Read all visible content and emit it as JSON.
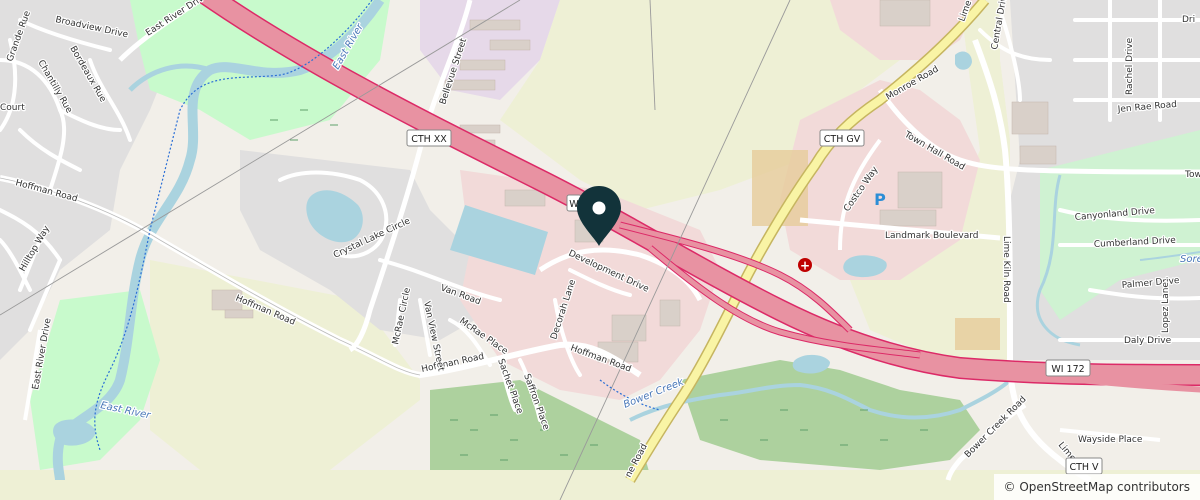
{
  "map": {
    "roads": {
      "east_river_drive": "East River Drive",
      "broadview_drive": "Broadview Drive",
      "grande_rue": "Grande Rue",
      "bordeaux_rue": "Bordeaux Rue",
      "chantilly_rue": "Chantilly Rue",
      "court": "Court",
      "hoffman_road": "Hoffman Road",
      "hilltop_way": "Hilltop Way",
      "bellevue_street": "Bellevue Street",
      "crystal_lake_circle": "Crystal Lake Circle",
      "van_road": "Van Road",
      "mcrae_circle": "McRae Circle",
      "van_view_street": "Van View Street",
      "mcrae_place": "McRae Place",
      "sachet_place": "Sachet Place",
      "saffron_place": "Saffron Place",
      "decorah_lane": "Decorah Lane",
      "development_drive": "Development Drive",
      "monroe_road": "Monroe Road",
      "town_hall_road": "Town Hall Road",
      "costco_way": "Costco Way",
      "landmark_boulevard": "Landmark Boulevard",
      "central_drive": "Central Drive",
      "rachel_drive": "Rachel Drive",
      "jen_rae_road": "Jen Rae Road",
      "lime_kiln_road": "Lime Kiln Road",
      "lime_top": "Lime",
      "canyonland_drive": "Canyonland Drive",
      "cumberland_drive": "Cumberland Drive",
      "palmer_drive": "Palmer Drive",
      "lopez_lane": "Lopez Lane",
      "daly_drive": "Daly Drive",
      "bower_creek_road": "Bower Creek Road",
      "wayside_place": "Wayside Place",
      "lime_bottom": "Lime",
      "monroe_bottom": "ne Road",
      "tow": "Tow",
      "dri": "Dri",
      "sore": "Sore"
    },
    "shields": {
      "cth_xx": "CTH XX",
      "cth_gv": "CTH GV",
      "wi_172": "WI 172",
      "cth_v": "CTH V",
      "w_small": "W"
    },
    "water": {
      "east_river_a": "East River",
      "east_river_b": "East River",
      "bower_creek": "Bower Creek"
    },
    "poi": {
      "parking": "P",
      "hospital": "+"
    }
  },
  "attribution": "© OpenStreetMap contributors",
  "colors": {
    "background": "#f2efe9",
    "residential": "#e0dfdf",
    "commercial": "#f2dad9",
    "retail": "#fce2dc",
    "farmland": "#eef0d5",
    "park": "#c8facc",
    "wetland": "#d2e5b8",
    "forest": "#add19e",
    "water": "#aad3df",
    "motorway": "#e892a2",
    "motorway_casing": "#dc2a67",
    "trunk": "#f9f4a5",
    "minor_road": "#ffffff",
    "building": "#d9d0c9",
    "marker": "#12333a"
  }
}
